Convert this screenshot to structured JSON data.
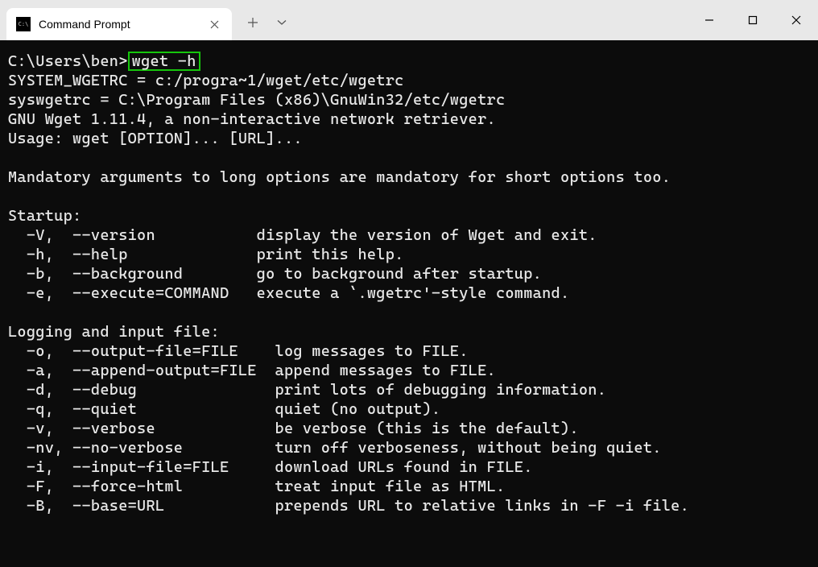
{
  "titlebar": {
    "tab_title": "Command Prompt",
    "tab_icon_text": "C:\\"
  },
  "terminal": {
    "prompt": "C:\\Users\\ben>",
    "command": "wget -h",
    "lines": [
      "SYSTEM_WGETRC = c:/progra~1/wget/etc/wgetrc",
      "syswgetrc = C:\\Program Files (x86)\\GnuWin32/etc/wgetrc",
      "GNU Wget 1.11.4, a non-interactive network retriever.",
      "Usage: wget [OPTION]... [URL]...",
      "",
      "Mandatory arguments to long options are mandatory for short options too.",
      "",
      "Startup:",
      "  -V,  --version           display the version of Wget and exit.",
      "  -h,  --help              print this help.",
      "  -b,  --background        go to background after startup.",
      "  -e,  --execute=COMMAND   execute a `.wgetrc'-style command.",
      "",
      "Logging and input file:",
      "  -o,  --output-file=FILE    log messages to FILE.",
      "  -a,  --append-output=FILE  append messages to FILE.",
      "  -d,  --debug               print lots of debugging information.",
      "  -q,  --quiet               quiet (no output).",
      "  -v,  --verbose             be verbose (this is the default).",
      "  -nv, --no-verbose          turn off verboseness, without being quiet.",
      "  -i,  --input-file=FILE     download URLs found in FILE.",
      "  -F,  --force-html          treat input file as HTML.",
      "  -B,  --base=URL            prepends URL to relative links in -F -i file."
    ]
  }
}
